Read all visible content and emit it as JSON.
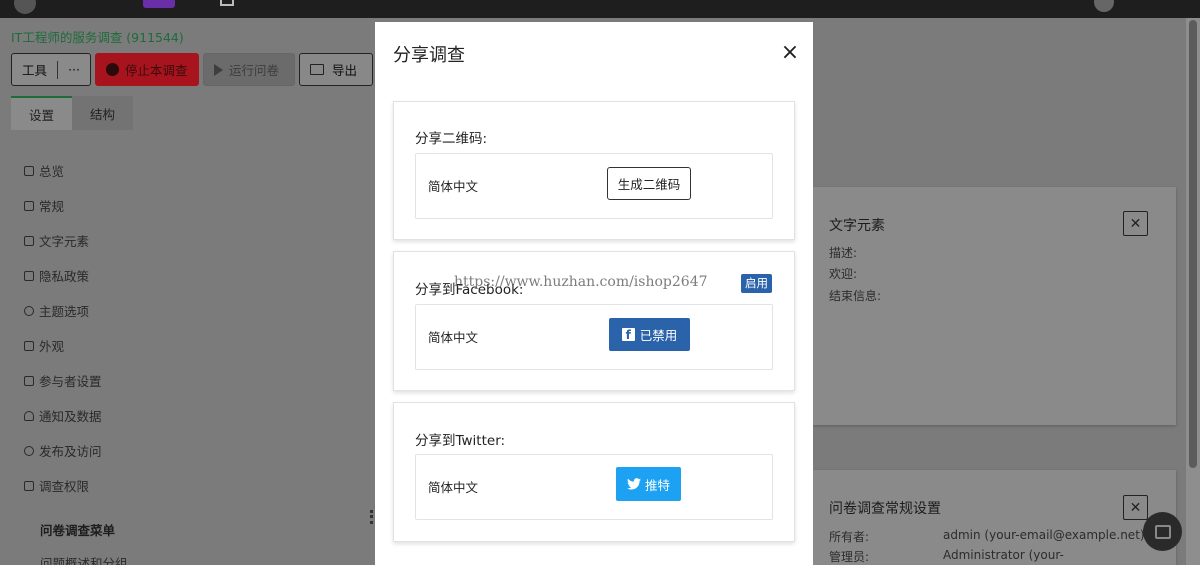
{
  "survey": {
    "title": "IT工程师的服务调查 (911544)"
  },
  "toolbar": {
    "tools_label": "工具",
    "more_label": "···",
    "stop_label": "停止本调查",
    "run_label": "运行问卷",
    "export_label": "导出"
  },
  "tabs": [
    {
      "label": "设置"
    },
    {
      "label": "结构"
    }
  ],
  "sidebar": {
    "items": [
      {
        "label": "总览"
      },
      {
        "label": "常规"
      },
      {
        "label": "文字元素"
      },
      {
        "label": "隐私政策"
      },
      {
        "label": "主题选项"
      },
      {
        "label": "外观"
      },
      {
        "label": "参与者设置"
      },
      {
        "label": "通知及数据"
      },
      {
        "label": "发布及访问"
      },
      {
        "label": "调查权限"
      }
    ],
    "section_label": "问卷调查菜单",
    "sub_item_label": "问题概述和分组"
  },
  "right_cards": {
    "text_elements": {
      "title": "文字元素",
      "fields": [
        "描述:",
        "欢迎:",
        "结束信息:"
      ]
    },
    "general_settings": {
      "title": "问卷调查常规设置",
      "rows": [
        {
          "key": "所有者:",
          "value": "admin (your-email@example.net)"
        },
        {
          "key": "管理员:",
          "value": "Administrator (your-"
        }
      ]
    }
  },
  "modal": {
    "title": "分享调查",
    "close_glyph": "×",
    "qr": {
      "heading": "分享二维码:",
      "language": "简体中文",
      "button_label": "生成二维码"
    },
    "facebook": {
      "heading": "分享到Facebook:",
      "badge_label": "启用",
      "language": "简体中文",
      "button_label": "已禁用",
      "watermark": "https://www.huzhan.com/ishop2647"
    },
    "twitter": {
      "heading": "分享到Twitter:",
      "language": "简体中文",
      "button_label": "推特"
    }
  },
  "colors": {
    "facebook_blue": "#2b63ab",
    "twitter_blue": "#1da1f2",
    "stop_red": "#d51f2a",
    "brand_green": "#1f6b3c"
  }
}
